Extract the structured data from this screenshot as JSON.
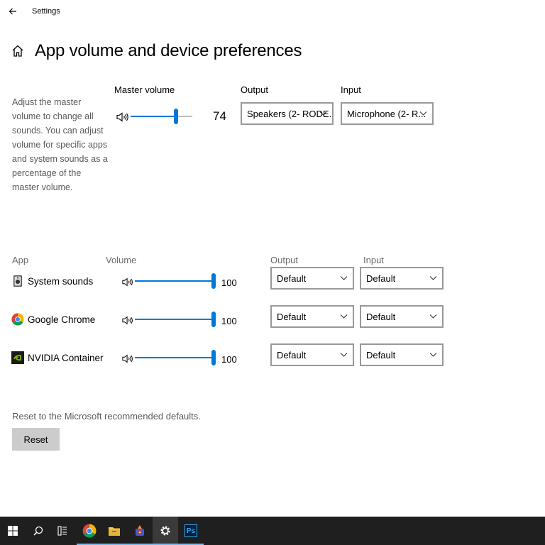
{
  "window": {
    "title": "Settings"
  },
  "page": {
    "title": "App volume and device preferences"
  },
  "description": "Adjust the master volume to change all sounds. You can adjust volume for specific apps and system sounds as a percentage of the master volume.",
  "master": {
    "label": "Master volume",
    "value": "74",
    "level": 0.74,
    "output_label": "Output",
    "output_value": "Speakers (2- RODE...",
    "input_label": "Input",
    "input_value": "Microphone (2- R..."
  },
  "apps_header": {
    "app": "App",
    "volume": "Volume",
    "output": "Output",
    "input": "Input"
  },
  "apps": [
    {
      "name": "System sounds",
      "value": "100",
      "level": 1.0,
      "output": "Default",
      "input": "Default",
      "icon": "system-sounds-icon"
    },
    {
      "name": "Google Chrome",
      "value": "100",
      "level": 1.0,
      "output": "Default",
      "input": "Default",
      "icon": "chrome-icon"
    },
    {
      "name": "NVIDIA Container",
      "value": "100",
      "level": 1.0,
      "output": "Default",
      "input": "Default",
      "icon": "nvidia-icon"
    }
  ],
  "reset": {
    "description": "Reset to the Microsoft recommended defaults.",
    "button": "Reset"
  },
  "taskbar": {
    "items": [
      "start-icon",
      "search-icon",
      "task-view-icon",
      "chrome-icon",
      "file-explorer-icon",
      "app-icon",
      "settings-icon",
      "photoshop-icon"
    ],
    "photoshop_label": "Ps"
  },
  "colors": {
    "accent": "#0078d7",
    "taskbar": "#1f1f1f",
    "button": "#cccccc"
  }
}
